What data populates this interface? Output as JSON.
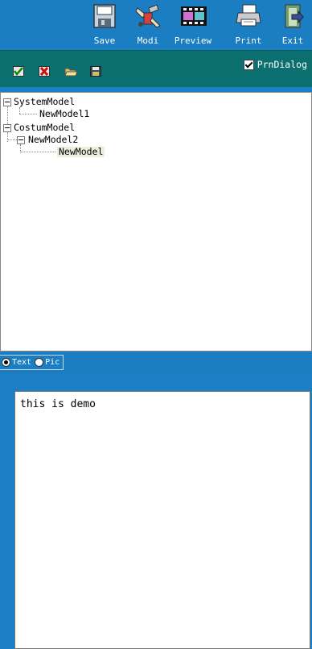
{
  "toolbar": {
    "buttons": [
      {
        "label": "Save",
        "icon": "save-icon"
      },
      {
        "label": "Modi",
        "icon": "modify-icon"
      },
      {
        "label": "Preview",
        "icon": "preview-icon"
      },
      {
        "label": "Print",
        "icon": "printer-icon"
      },
      {
        "label": "Exit",
        "icon": "exit-icon"
      }
    ]
  },
  "subtoolbar": {
    "icons": [
      "check-icon",
      "delete-icon",
      "open-folder-icon",
      "floppy-icon"
    ],
    "prn_dialog_label": "PrnDialog",
    "prn_dialog_checked": true
  },
  "tree": {
    "nodes": [
      {
        "label": "SystemModel",
        "level": 0,
        "expanded": true
      },
      {
        "label": "NewModel1",
        "level": 1
      },
      {
        "label": "CostumModel",
        "level": 0,
        "expanded": true
      },
      {
        "label": "NewModel2",
        "level": 1,
        "expanded": true
      },
      {
        "label": "NewModel",
        "level": 2,
        "selected": true
      }
    ]
  },
  "mode": {
    "options": [
      "Text",
      "Pic"
    ],
    "selected": "Text"
  },
  "editor": {
    "content": "this is demo"
  },
  "colors": {
    "toolbar_bg": "#1b7ec3",
    "subtoolbar_bg": "#0b6f6f",
    "selection_bg": "#eeeedd"
  }
}
